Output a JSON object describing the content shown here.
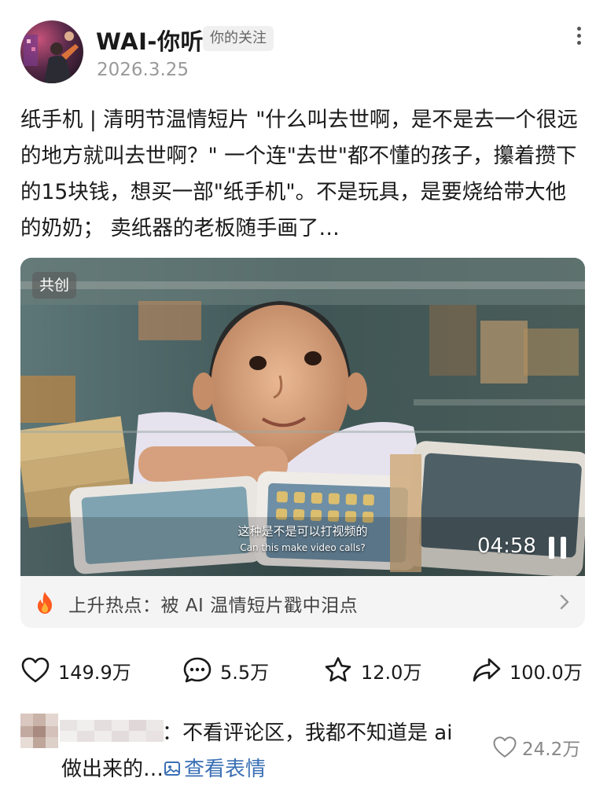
{
  "author": {
    "name": "WAI-你听",
    "follow_badge": "你的关注",
    "date": "2026.3.25"
  },
  "post": {
    "text": "纸手机 | 清明节温情短片 \"什么叫去世啊，是不是去一个很远的地方就叫去世啊？\" 一个连\"去世\"都不懂的孩子，攥着攒下的15块钱，想买一部\"纸手机\"。不是玩具，是要烧给带大他的奶奶； 卖纸器的老板随手画了…"
  },
  "video": {
    "tag": "共创",
    "subtitle_zh": "这种是不是可以打视频的",
    "subtitle_en": "Can this make video calls?",
    "duration": "04:58"
  },
  "hot_topic": {
    "text": "上升热点：被 AI 温情短片戳中泪点",
    "accent": "#ff5a1f"
  },
  "actions": {
    "likes": "149.9万",
    "comments": "5.5万",
    "favorites": "12.0万",
    "shares": "100.0万"
  },
  "icons": [
    "more-icon",
    "flame-icon",
    "chevron-right-icon",
    "heart-icon",
    "comment-bubble-icon",
    "star-icon",
    "share-arrow-icon",
    "pause-icon",
    "image-icon"
  ],
  "top_comment": {
    "text_line1": "：不看评论区，我都不知道是 ai",
    "text_line2": "做出来的…",
    "view_emoji": "查看表情",
    "likes": "24.2万"
  }
}
